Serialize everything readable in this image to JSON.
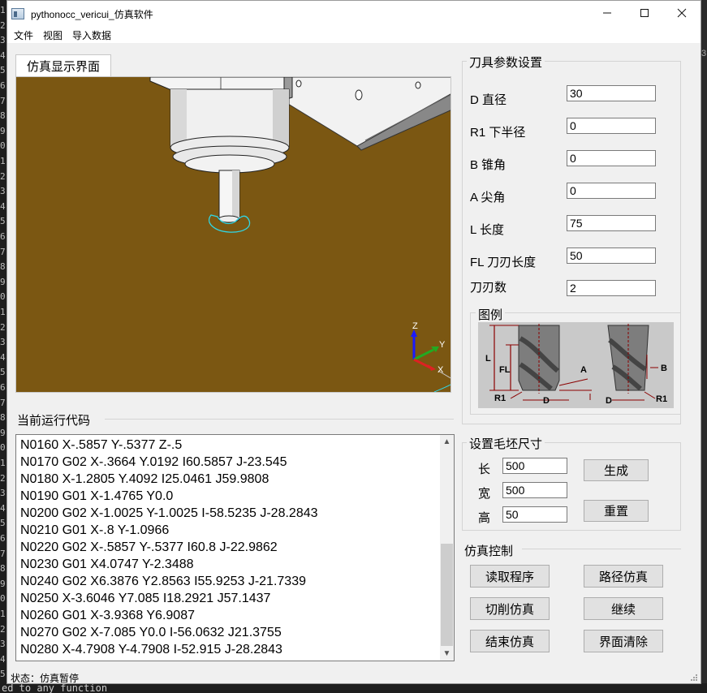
{
  "window": {
    "title": "pythonocc_vericui_仿真软件",
    "controls": [
      "—",
      "☐",
      "✕"
    ]
  },
  "menu": [
    "文件",
    "视图",
    "导入数据"
  ],
  "display_tab": "仿真显示界面",
  "viewport": {
    "background": "#7b5712",
    "axes": {
      "z": "Z",
      "y": "Y",
      "x": "X"
    }
  },
  "tool_params": {
    "title": "刀具参数设置",
    "fields": [
      {
        "label": "D 直径",
        "value": "30"
      },
      {
        "label": "R1 下半径",
        "value": "0"
      },
      {
        "label": "B 锥角",
        "value": "0"
      },
      {
        "label": "A 尖角",
        "value": "0"
      },
      {
        "label": "L 长度",
        "value": "75"
      },
      {
        "label": "FL 刀刃长度",
        "value": "50"
      },
      {
        "label": "刀刃数",
        "value": "2"
      }
    ],
    "legend_title": "图例",
    "legend_labels": {
      "L": "L",
      "FL": "FL",
      "R1": "R1",
      "D": "D",
      "A": "A",
      "B": "B",
      "D2": "D",
      "R1b": "R1"
    }
  },
  "code": {
    "title": "当前运行代码",
    "lines": [
      "N0160 X-.5857 Y-.5377 Z-.5",
      "N0170 G02 X-.3664 Y.0192 I60.5857 J-23.545",
      "N0180 X-1.2805 Y.4092 I25.0461 J59.9808",
      "N0190 G01 X-1.4765 Y0.0",
      "N0200 G02 X-1.0025 Y-1.0025 I-58.5235 J-28.2843",
      "N0210 G01 X-.8 Y-1.0966",
      "N0220 G02 X-.5857 Y-.5377 I60.8 J-22.9862",
      "N0230 G01 X4.0747 Y-2.3488",
      "N0240 G02 X6.3876 Y2.8563 I55.9253 J-21.7339",
      "N0250 X-3.6046 Y7.085 I18.2921 J57.1437",
      "N0260 G01 X-3.9368 Y6.9087",
      "N0270 G02 X-7.085 Y0.0 I-56.0632 J21.3755",
      "N0280 X-4.7908 Y-4.7908 I-52.915 J-28.2843"
    ]
  },
  "blank": {
    "title": "设置毛坯尺寸",
    "length_label": "长",
    "length_value": "500",
    "width_label": "宽",
    "width_value": "500",
    "height_label": "高",
    "height_value": "50",
    "generate_button": "生成",
    "reset_button": "重置"
  },
  "sim_control": {
    "title": "仿真控制",
    "read_program": "读取程序",
    "path_sim": "路径仿真",
    "cut_sim": "切削仿真",
    "continue": "继续",
    "end_sim": "结束仿真",
    "clear": "界面清除"
  },
  "status_text": "状态：仿真暂停",
  "background_editor": {
    "gutter_digits": [
      "1",
      "2",
      "3",
      "4",
      "5",
      "6",
      "7",
      "8",
      "9",
      "0",
      "1",
      "2",
      "3",
      "4",
      "5",
      "6",
      "7",
      "8",
      "9",
      "0",
      "1",
      "2",
      "3",
      "4",
      "5",
      "6",
      "7",
      "8",
      "9",
      "0",
      "1",
      "2",
      "3",
      "4",
      "5",
      "6",
      "7",
      "8",
      "9",
      "0",
      "1",
      "2",
      "3",
      "4",
      "5"
    ],
    "bottom_text": "ed to any function"
  }
}
